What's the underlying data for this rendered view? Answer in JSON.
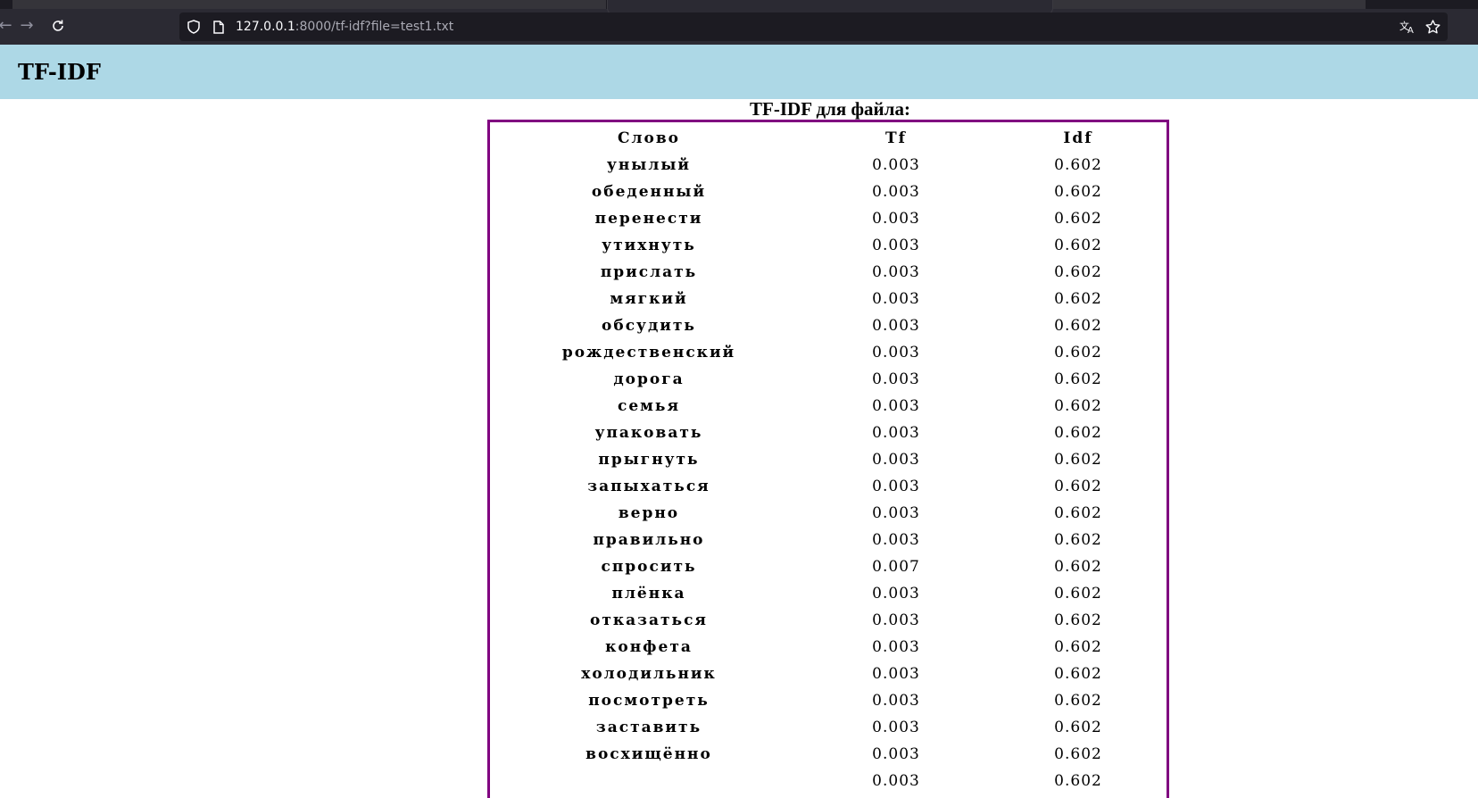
{
  "browser": {
    "url_host": "127.0.0.1",
    "url_rest": ":8000/tf-idf?file=test1.txt"
  },
  "header": {
    "title": "TF-IDF"
  },
  "table": {
    "caption": "TF-IDF для файла:",
    "columns": [
      "Слово",
      "Tf",
      "Idf"
    ],
    "rows": [
      [
        "унылый",
        "0.003",
        "0.602"
      ],
      [
        "обеденный",
        "0.003",
        "0.602"
      ],
      [
        "перенести",
        "0.003",
        "0.602"
      ],
      [
        "утихнуть",
        "0.003",
        "0.602"
      ],
      [
        "прислать",
        "0.003",
        "0.602"
      ],
      [
        "мягкий",
        "0.003",
        "0.602"
      ],
      [
        "обсудить",
        "0.003",
        "0.602"
      ],
      [
        "рождественский",
        "0.003",
        "0.602"
      ],
      [
        "дорога",
        "0.003",
        "0.602"
      ],
      [
        "семья",
        "0.003",
        "0.602"
      ],
      [
        "упаковать",
        "0.003",
        "0.602"
      ],
      [
        "прыгнуть",
        "0.003",
        "0.602"
      ],
      [
        "запыхаться",
        "0.003",
        "0.602"
      ],
      [
        "верно",
        "0.003",
        "0.602"
      ],
      [
        "правильно",
        "0.003",
        "0.602"
      ],
      [
        "спросить",
        "0.007",
        "0.602"
      ],
      [
        "плёнка",
        "0.003",
        "0.602"
      ],
      [
        "отказаться",
        "0.003",
        "0.602"
      ],
      [
        "конфета",
        "0.003",
        "0.602"
      ],
      [
        "холодильник",
        "0.003",
        "0.602"
      ],
      [
        "посмотреть",
        "0.003",
        "0.602"
      ],
      [
        "заставить",
        "0.003",
        "0.602"
      ],
      [
        "восхищённо",
        "0.003",
        "0.602"
      ],
      [
        "",
        "0.003",
        "0.602"
      ]
    ]
  },
  "colors": {
    "header_bg": "#add8e6",
    "table_border": "#800080"
  }
}
